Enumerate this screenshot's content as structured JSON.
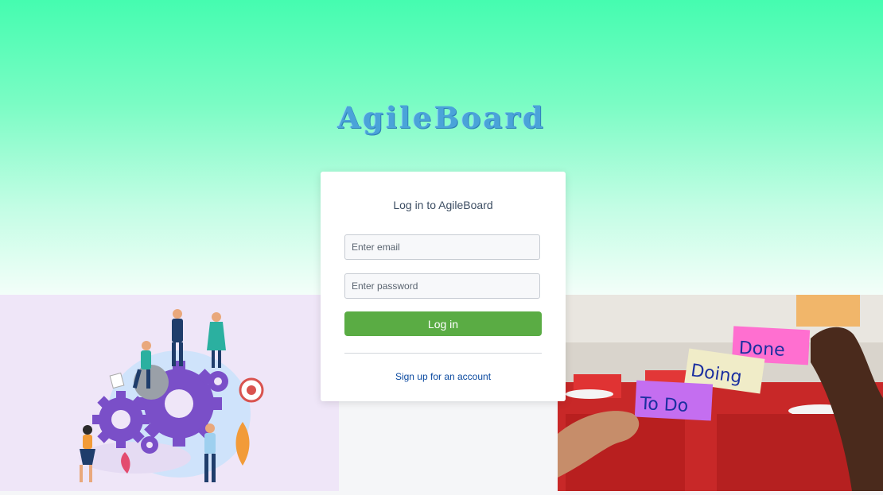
{
  "brand": {
    "name": "AgileBoard"
  },
  "login_card": {
    "title": "Log in to AgileBoard",
    "email_placeholder": "Enter email",
    "password_placeholder": "Enter password",
    "login_label": "Log in",
    "signup_label": "Sign up for an account"
  },
  "sticky_notes": {
    "done": "Done",
    "doing": "Doing",
    "todo": "To Do"
  },
  "colors": {
    "accent_green": "#5aac44",
    "link_blue": "#0b4aa0",
    "brand_blue": "#4aa3d9"
  }
}
